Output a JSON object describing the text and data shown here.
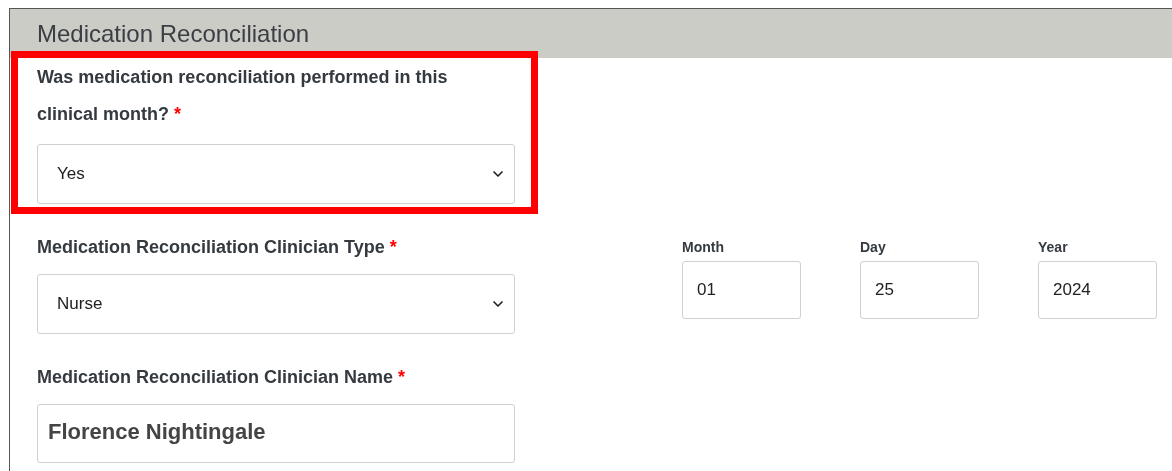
{
  "section": {
    "title": "Medication Reconciliation"
  },
  "fields": [
    {
      "kind": "select",
      "label": "Was medication reconciliation performed in this clinical month?",
      "required_mark": "*",
      "value": "Yes",
      "highlighted": true
    },
    {
      "kind": "select",
      "label": "Medication Reconciliation Clinician Type",
      "required_mark": "*",
      "value": "Nurse",
      "highlighted": false
    },
    {
      "kind": "text",
      "label": "Medication Reconciliation Clinician Name",
      "required_mark": "*",
      "value": "Florence Nightingale",
      "highlighted": false
    }
  ],
  "date": [
    {
      "label": "Month",
      "value": "01"
    },
    {
      "label": "Day",
      "value": "25"
    },
    {
      "label": "Year",
      "value": "2024"
    }
  ]
}
